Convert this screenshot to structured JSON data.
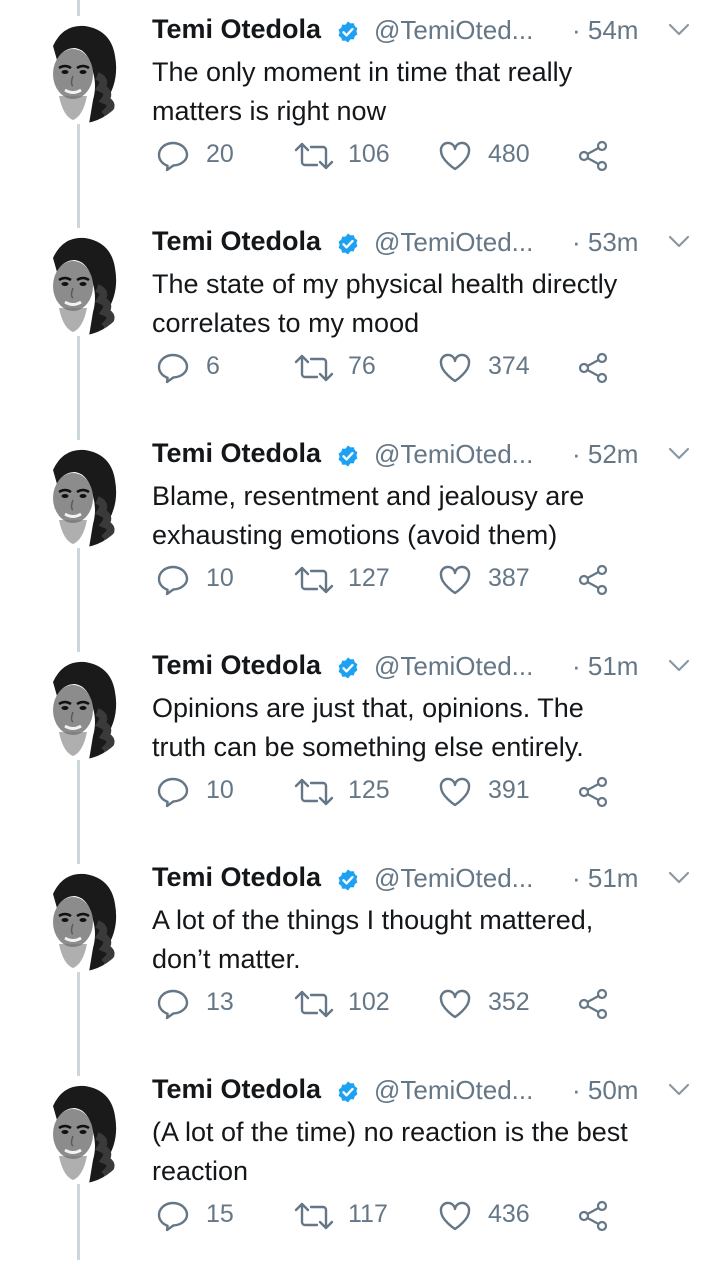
{
  "author": {
    "name": "Temi Otedola",
    "handle": "@TemiOted..."
  },
  "tweets": [
    {
      "time": "· 54m",
      "lines": [
        "The only moment in time that really",
        "matters is right now"
      ],
      "replies": "20",
      "retweets": "106",
      "likes": "480"
    },
    {
      "time": "· 53m",
      "lines": [
        "The state of my physical health directly",
        "correlates to my mood"
      ],
      "replies": "6",
      "retweets": "76",
      "likes": "374"
    },
    {
      "time": "· 52m",
      "lines": [
        "Blame, resentment and jealousy are",
        "exhausting emotions (avoid them)"
      ],
      "replies": "10",
      "retweets": "127",
      "likes": "387"
    },
    {
      "time": "· 51m",
      "lines": [
        "Opinions are just that, opinions. The",
        "truth can be something else entirely."
      ],
      "replies": "10",
      "retweets": "125",
      "likes": "391"
    },
    {
      "time": "· 51m",
      "lines": [
        "A lot of the things I thought mattered,",
        "don’t matter."
      ],
      "replies": "13",
      "retweets": "102",
      "likes": "352"
    },
    {
      "time": "· 50m",
      "lines": [
        "(A lot of the time) no reaction is the best",
        "reaction"
      ],
      "replies": "15",
      "retweets": "117",
      "likes": "436"
    }
  ],
  "icons": {
    "verified": "verified-badge-icon",
    "caret": "chevron-down-icon",
    "reply": "reply-icon",
    "retweet": "retweet-icon",
    "like": "heart-icon",
    "share": "share-icon"
  },
  "colors": {
    "text": "#14171a",
    "secondary": "#657786",
    "verified": "#1da1f2",
    "thread_line": "#ccd6dd"
  }
}
